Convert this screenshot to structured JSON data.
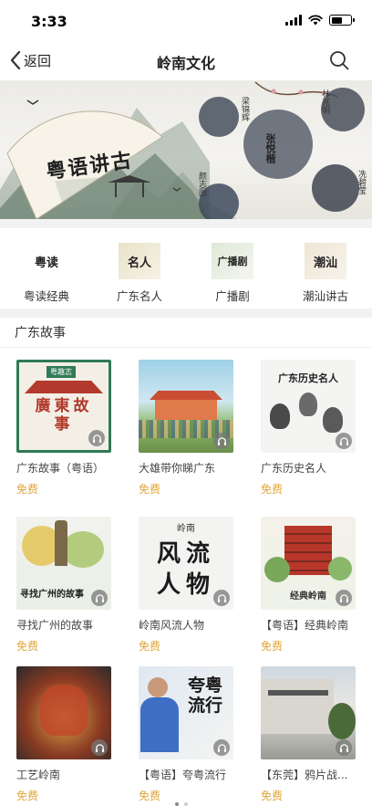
{
  "status": {
    "time": "3:33"
  },
  "nav": {
    "back_label": "返回",
    "title": "岭南文化"
  },
  "banner": {
    "title": "粤语讲古",
    "names": [
      "梁锦辉",
      "张悦楷",
      "林兆明",
      "颜志图",
      "冼碧莹"
    ]
  },
  "categories": [
    {
      "label": "粤读经典",
      "icon_text": "粤读",
      "icon": "calligraphy-icon"
    },
    {
      "label": "广东名人",
      "icon_text": "名人",
      "icon": "calligraphy-icon"
    },
    {
      "label": "广播剧",
      "icon_text": "广播剧",
      "icon": "calligraphy-icon"
    },
    {
      "label": "潮汕讲古",
      "icon_text": "潮汕",
      "icon": "calligraphy-icon"
    }
  ],
  "section": {
    "title": "广东故事"
  },
  "items": [
    {
      "title": "广东故事（粤语）",
      "price": "免费",
      "cover_text": "廣東故事",
      "cover_tag": "粤趣志"
    },
    {
      "title": "大雄带你睇广东",
      "price": "免费",
      "cover_text": ""
    },
    {
      "title": "广东历史名人",
      "price": "免费",
      "cover_text": "广东历史名人"
    },
    {
      "title": "寻找广州的故事",
      "price": "免费",
      "cover_text": "寻找广州的故事"
    },
    {
      "title": "岭南风流人物",
      "price": "免费",
      "cover_text": "风流人物",
      "cover_tag": "岭南"
    },
    {
      "title": "【粤语】经典岭南",
      "price": "免费",
      "cover_text": "经典岭南"
    },
    {
      "title": "工艺岭南",
      "price": "免费",
      "cover_text": ""
    },
    {
      "title": "【粤语】夸粤流行",
      "price": "免费",
      "cover_text": "夸粤流行"
    },
    {
      "title": "【东莞】鸦片战...",
      "price": "免费",
      "cover_text": ""
    }
  ],
  "colors": {
    "price": "#e0a63a",
    "background": "#ffffff",
    "divider": "#f2f2f2"
  }
}
